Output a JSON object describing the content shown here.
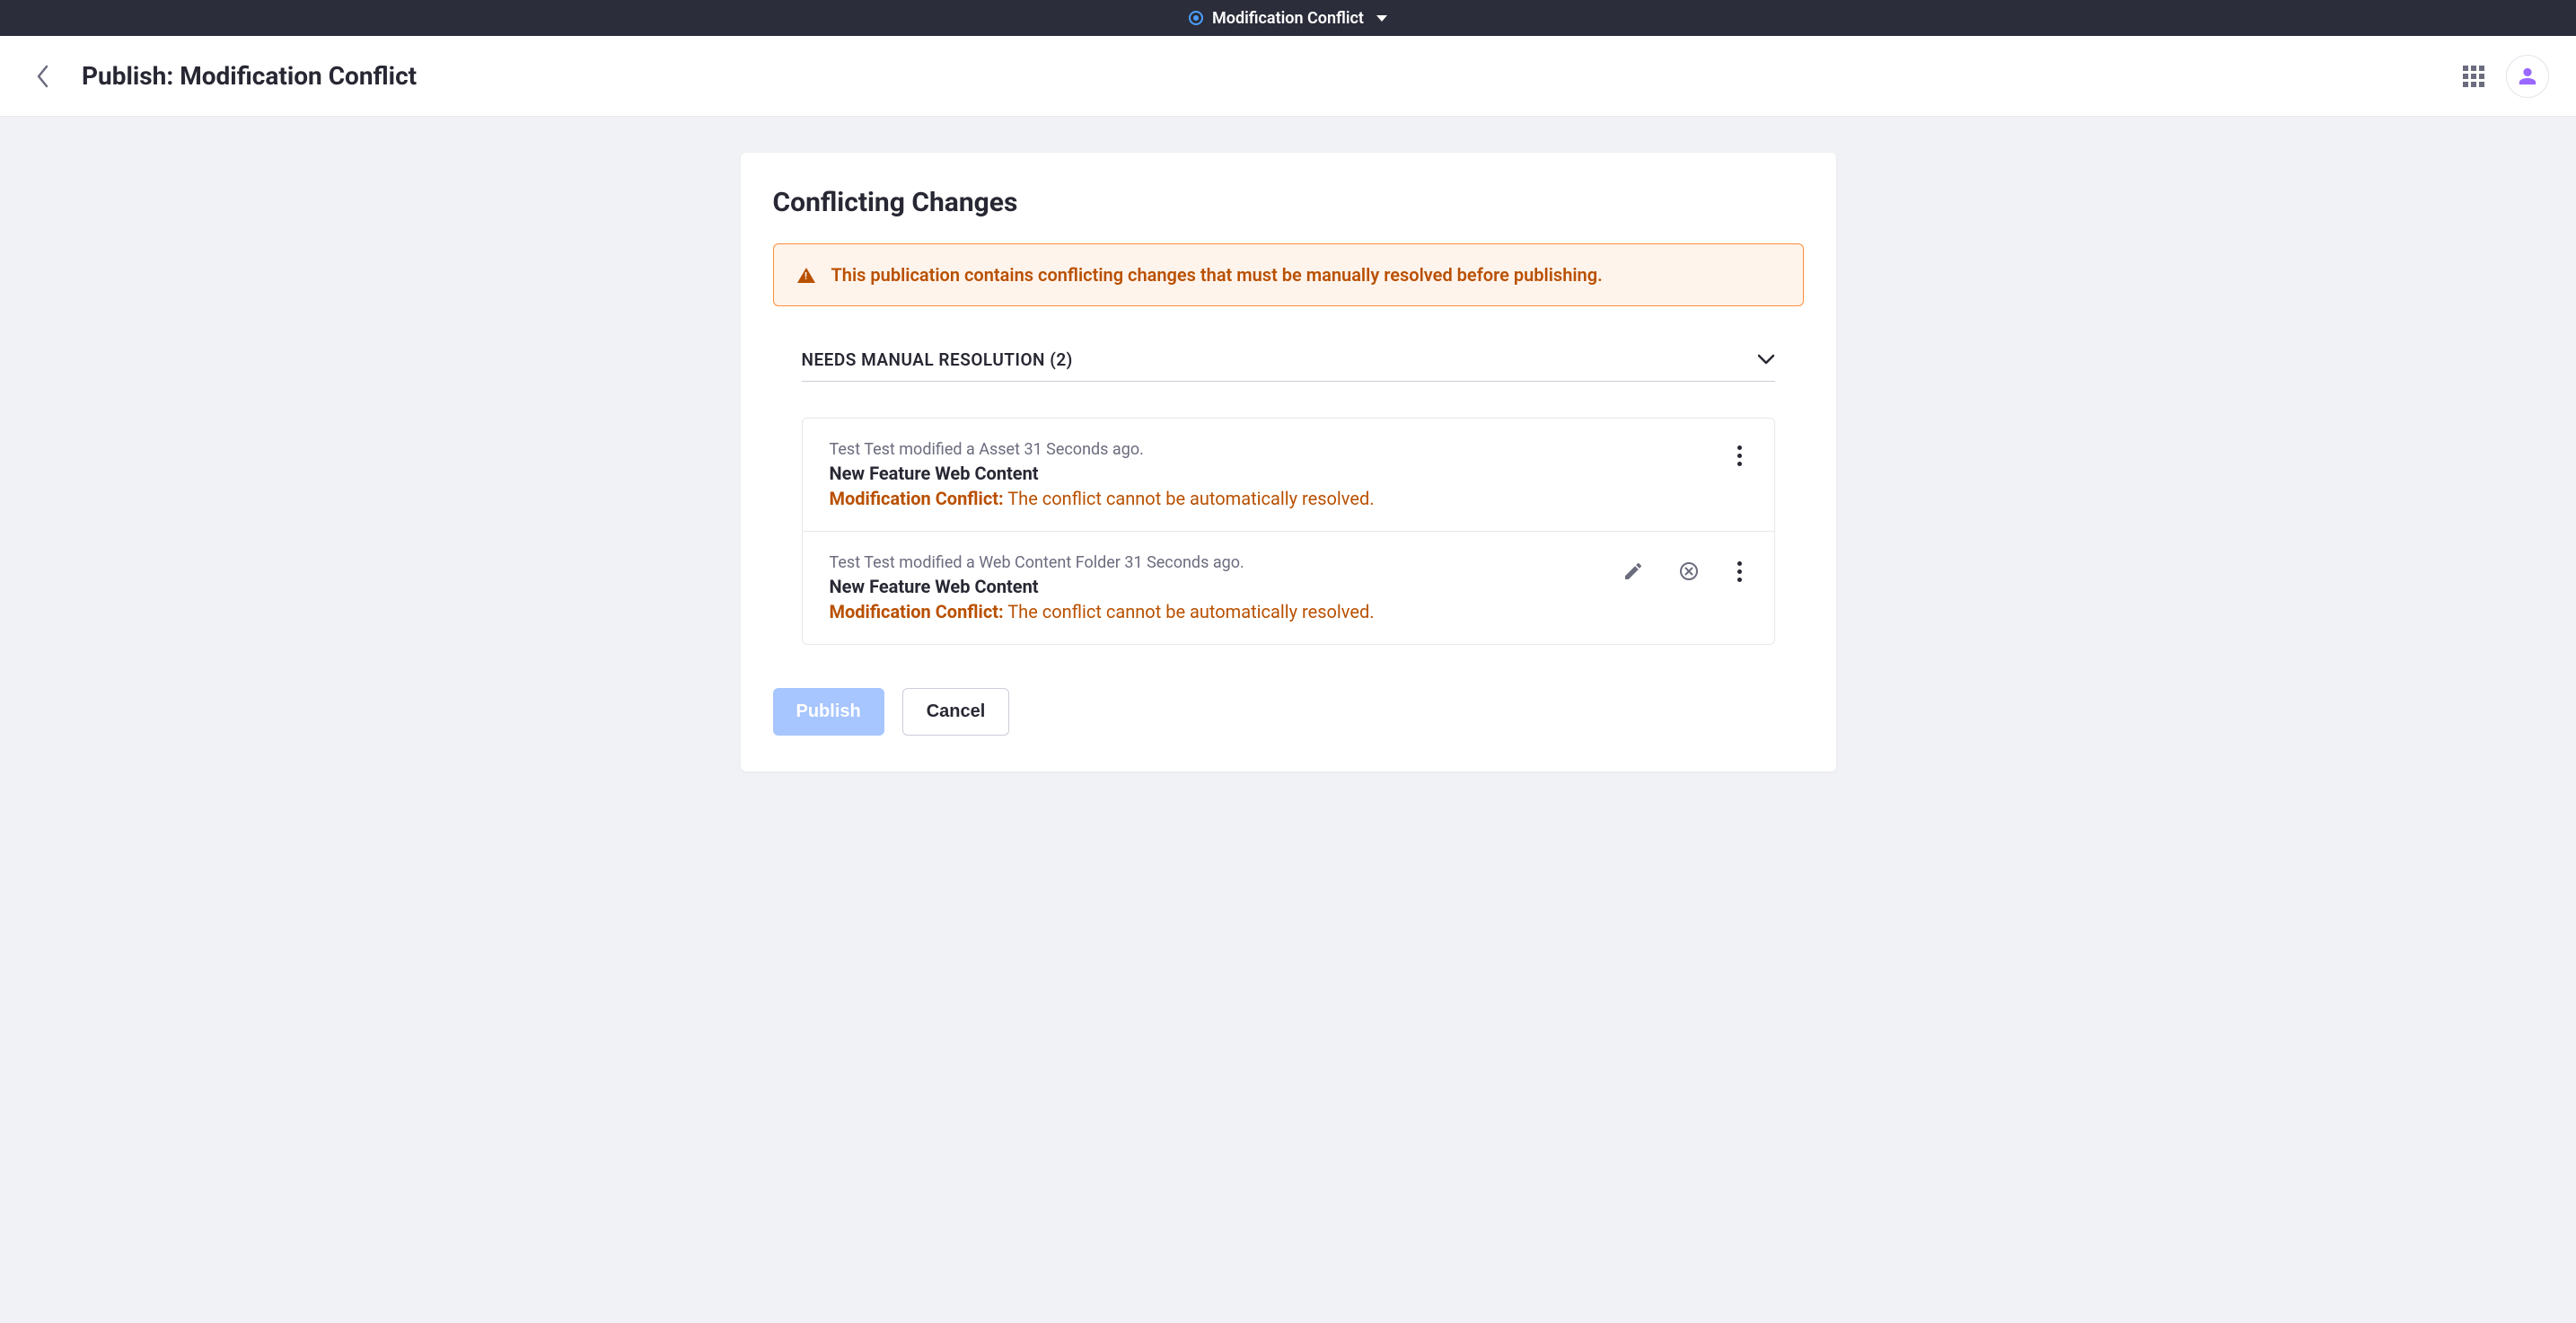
{
  "topbar": {
    "label": "Modification Conflict"
  },
  "header": {
    "title": "Publish: Modification Conflict"
  },
  "card": {
    "title": "Conflicting Changes",
    "alert": "This publication contains conflicting changes that must be manually resolved before publishing."
  },
  "section": {
    "title": "NEEDS MANUAL RESOLUTION (2)"
  },
  "conflicts": [
    {
      "meta": "Test Test modified a Asset 31 Seconds ago.",
      "title": "New Feature Web Content",
      "status_label": "Modification Conflict:",
      "status_desc": " The conflict cannot be automatically resolved.",
      "has_edit": false,
      "has_discard": false
    },
    {
      "meta": "Test Test modified a Web Content Folder 31 Seconds ago.",
      "title": "New Feature Web Content",
      "status_label": "Modification Conflict:",
      "status_desc": " The conflict cannot be automatically resolved.",
      "has_edit": true,
      "has_discard": true
    }
  ],
  "footer": {
    "publish": "Publish",
    "cancel": "Cancel"
  }
}
